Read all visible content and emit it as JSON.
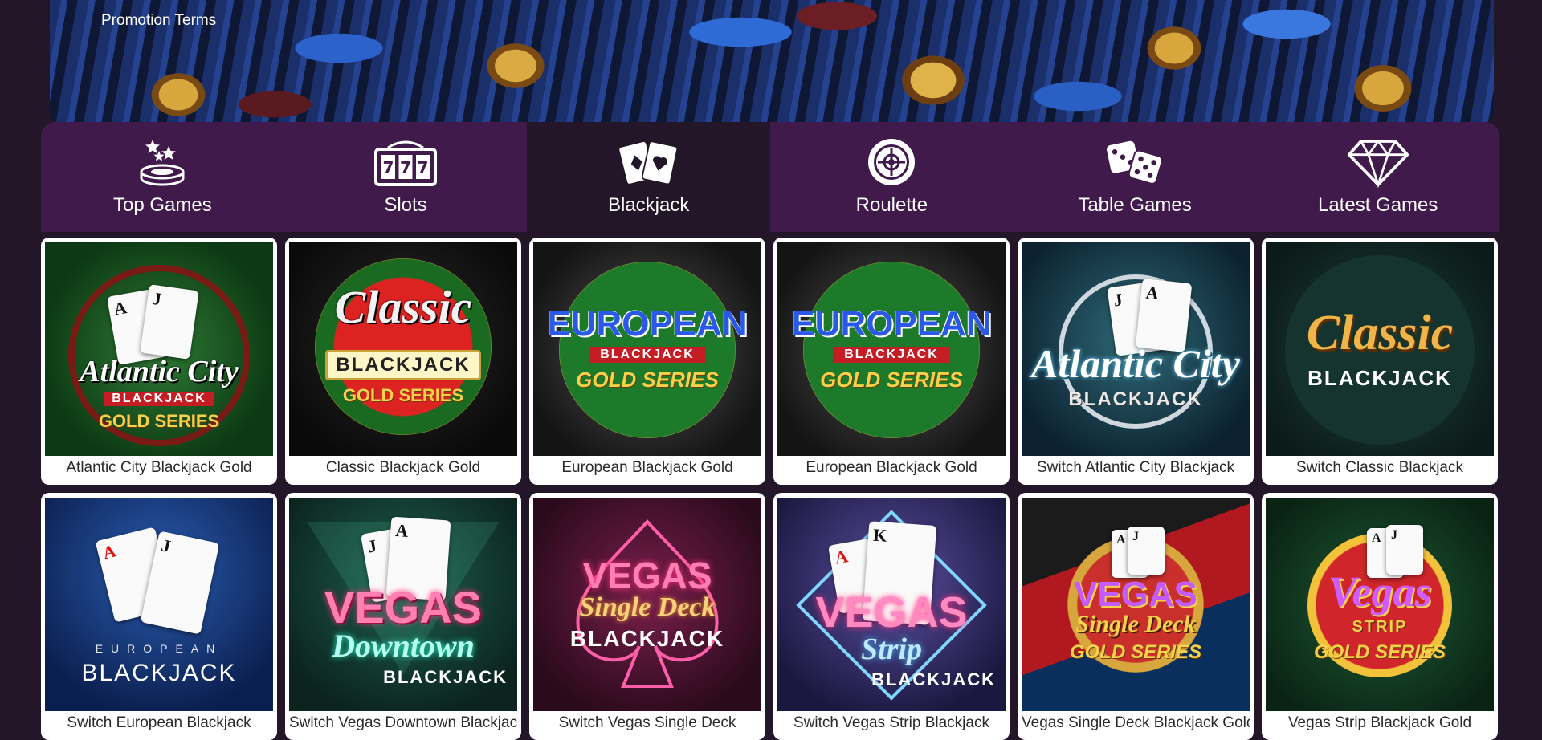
{
  "banner": {
    "promo_link": "Promotion Terms"
  },
  "nav": [
    {
      "label": "Top Games",
      "icon": "top-games-icon",
      "active": false
    },
    {
      "label": "Slots",
      "icon": "slots-icon",
      "active": false
    },
    {
      "label": "Blackjack",
      "icon": "blackjack-cards-icon",
      "active": true
    },
    {
      "label": "Roulette",
      "icon": "roulette-wheel-icon",
      "active": false
    },
    {
      "label": "Table Games",
      "icon": "dice-icon",
      "active": false
    },
    {
      "label": "Latest Games",
      "icon": "diamond-icon",
      "active": false
    }
  ],
  "games": [
    {
      "title": "Atlantic City Blackjack Gold",
      "logo": "Atlantic City",
      "sub": "BLACKJACK",
      "badge": "GOLD SERIES"
    },
    {
      "title": "Classic Blackjack Gold",
      "logo": "Classic",
      "sub": "BLACKJACK",
      "badge": "GOLD SERIES"
    },
    {
      "title": "European Blackjack Gold",
      "logo": "EUROPEAN",
      "sub": "BLACKJACK",
      "badge": "GOLD SERIES"
    },
    {
      "title": "European Blackjack Gold",
      "logo": "EUROPEAN",
      "sub": "BLACKJACK",
      "badge": "GOLD SERIES"
    },
    {
      "title": "Switch Atlantic City Blackjack",
      "logo": "Atlantic City",
      "sub": "BLACKJACK",
      "badge": ""
    },
    {
      "title": "Switch Classic Blackjack",
      "logo": "Classic",
      "sub": "BLACKJACK",
      "badge": ""
    },
    {
      "title": "Switch European Blackjack",
      "logo": "EUROPEAN",
      "sub": "BLACKJACK",
      "badge": ""
    },
    {
      "title": "Switch Vegas Downtown Blackjack",
      "logo": "VEGAS",
      "sub": "Downtown",
      "badge": "BLACKJACK"
    },
    {
      "title": "Switch Vegas Single Deck",
      "logo": "VEGAS",
      "sub": "Single Deck",
      "badge": "BLACKJACK"
    },
    {
      "title": "Switch Vegas Strip Blackjack",
      "logo": "VEGAS",
      "sub": "Strip",
      "badge": "BLACKJACK"
    },
    {
      "title": "Vegas Single Deck Blackjack Gold",
      "logo": "VEGAS",
      "sub": "Single Deck",
      "badge": "GOLD SERIES"
    },
    {
      "title": "Vegas Strip Blackjack Gold",
      "logo": "Vegas",
      "sub": "STRIP",
      "badge": "GOLD SERIES"
    }
  ],
  "colors": {
    "background": "#231628",
    "nav_background": "#401a4b",
    "nav_active": "#231628",
    "tile_background": "#ffffff"
  }
}
